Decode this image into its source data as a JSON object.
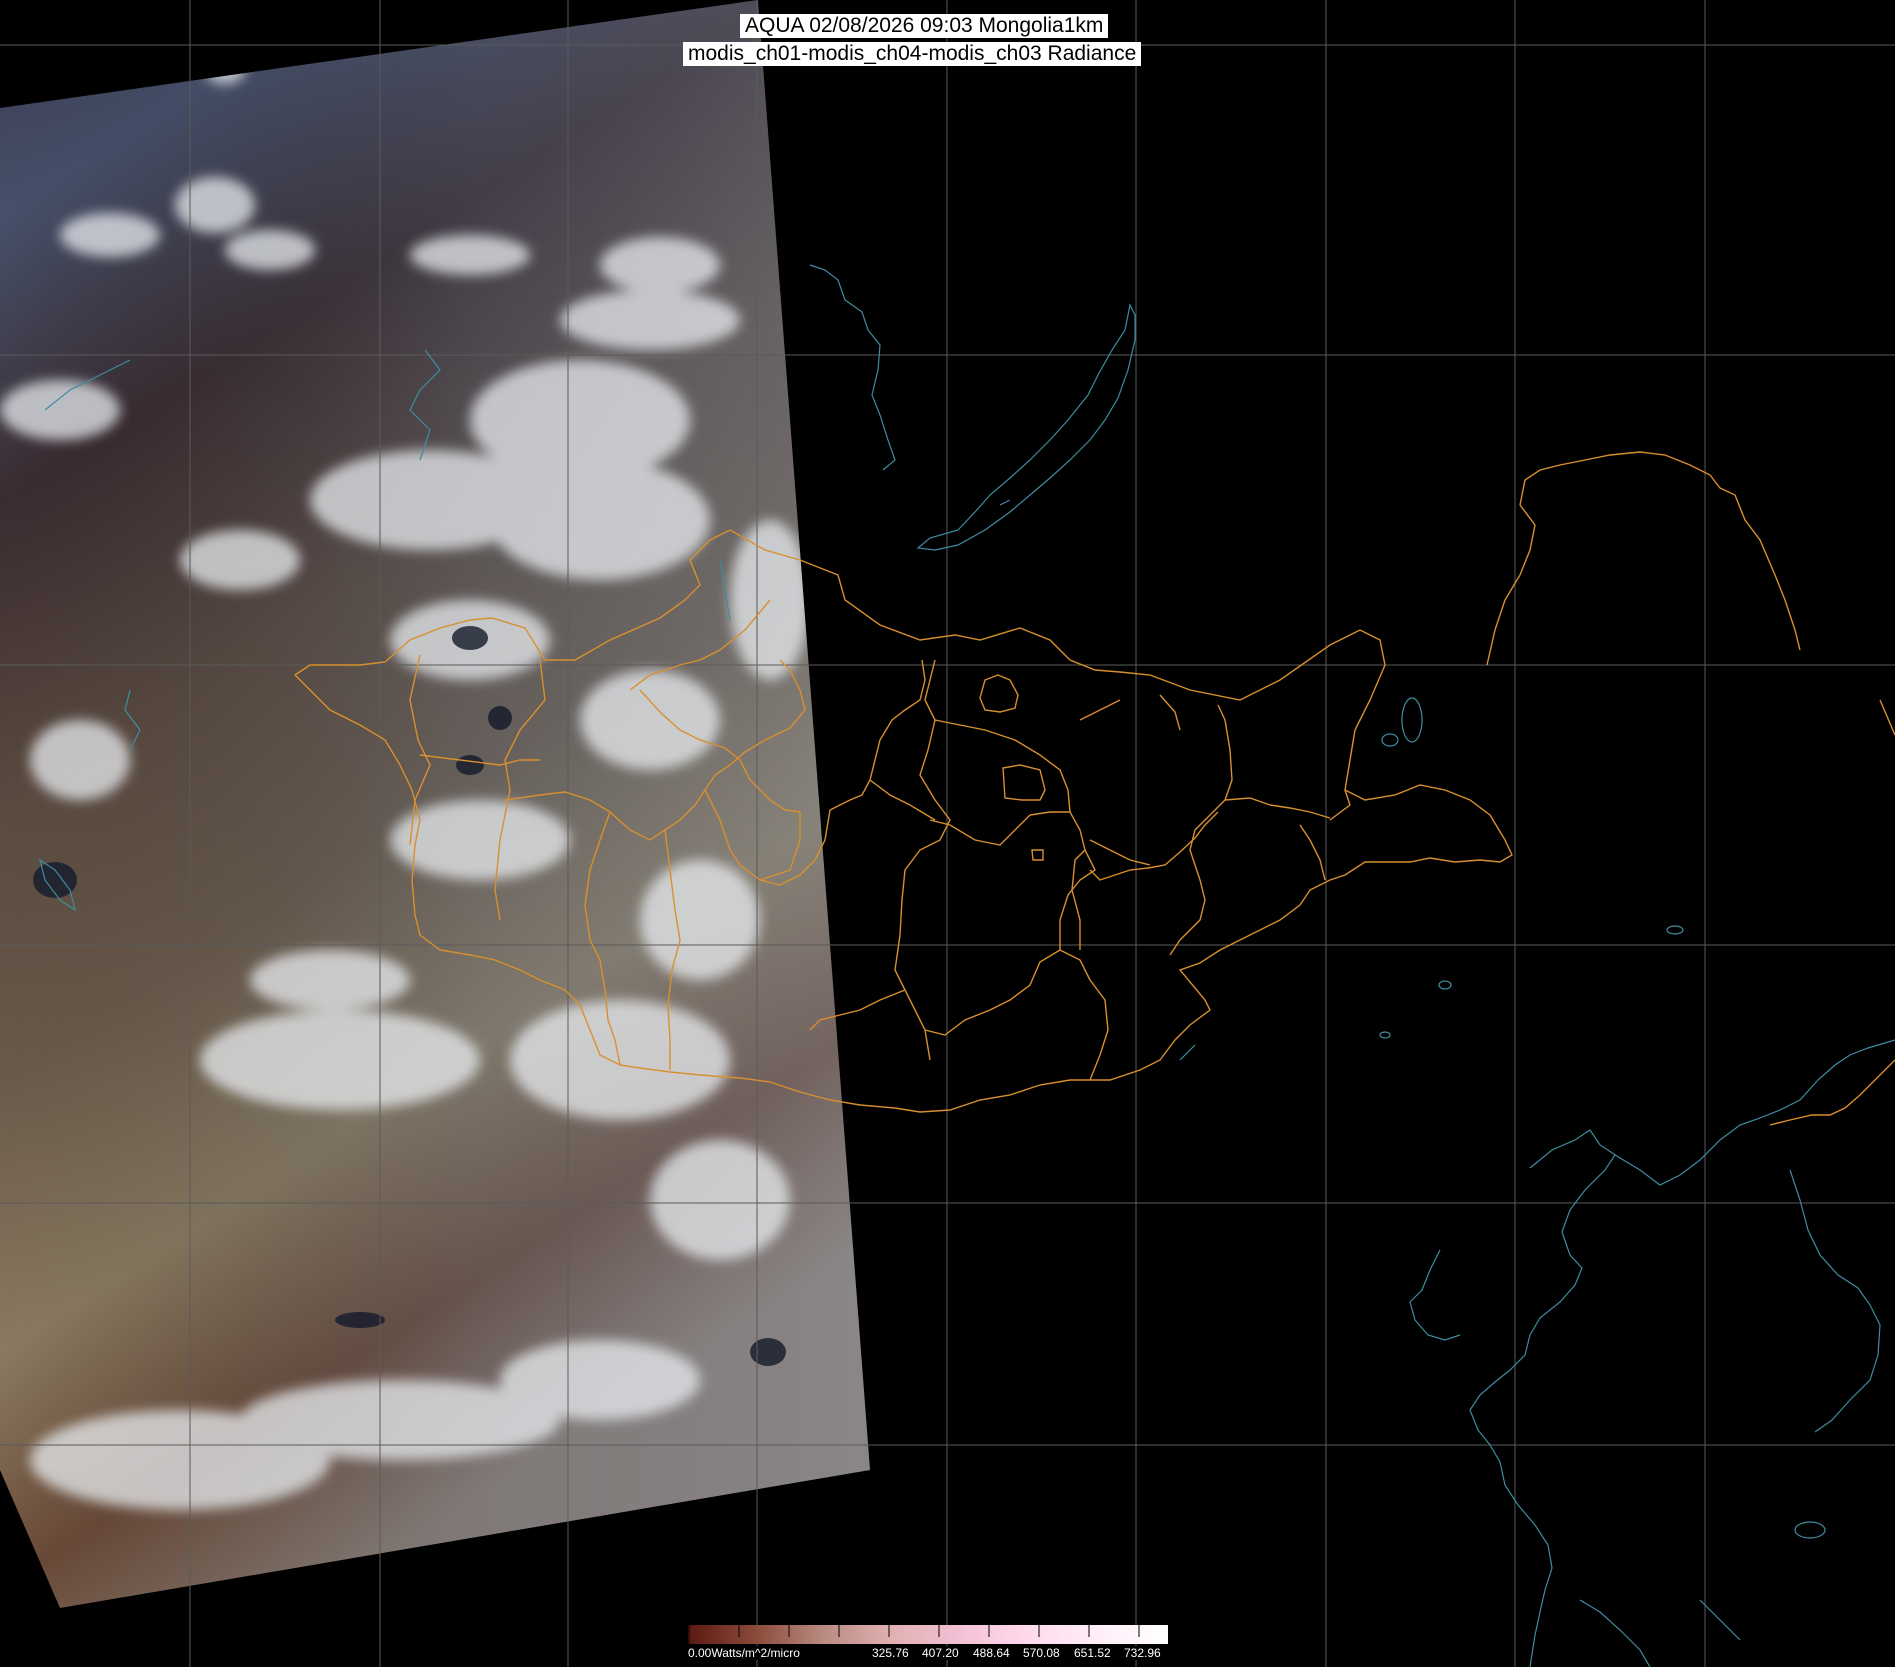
{
  "title": {
    "line1": "AQUA 02/08/2026 09:03 Mongolia1km",
    "line2": "modis_ch01-modis_ch04-modis_ch03 Radiance"
  },
  "colorbar": {
    "unit_label": "0.00Watts/m^2/micro",
    "ticks": [
      "325.76",
      "407.20",
      "488.64",
      "570.08",
      "651.52",
      "732.96"
    ],
    "colors": [
      "#5a1a12",
      "#8a4a3a",
      "#b88a80",
      "#dfb0b0",
      "#f2c0d4",
      "#ffd8ec",
      "#ffeef8",
      "#ffffff"
    ]
  },
  "map": {
    "background_color": "#000000",
    "grid_color": "#5a5a5a",
    "admin_border_color": "#d8902e",
    "coastline_color": "#3f8ca0",
    "features": [
      "swath-image",
      "lat-lon-grid",
      "admin-borders",
      "coastlines-lakes",
      "lake-baikal"
    ]
  }
}
